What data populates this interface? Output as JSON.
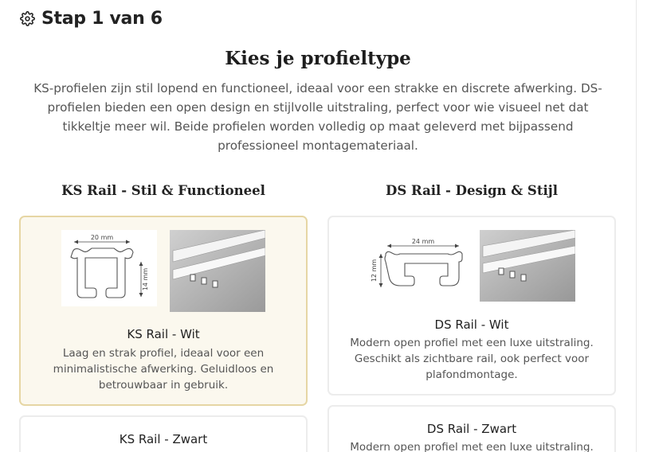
{
  "step": {
    "title": "Stap 1 van 6",
    "icon": "gear-icon"
  },
  "heading": "Kies je profieltype",
  "intro": "KS-profielen zijn stil lopend en functioneel, ideaal voor een strakke en discrete afwerking. DS-profielen bieden een open design en stijlvolle uitstraling, perfect voor wie visueel net dat tikkeltje meer wil. Beide profielen worden volledig op maat geleverd met bijpassend professioneel montagemateriaal.",
  "columns": {
    "ks": {
      "title": "KS Rail - Stil & Functioneel",
      "cards": [
        {
          "name": "KS Rail - Wit",
          "description": "Laag en strak profiel, ideaal voor een minimalistische afwerking. Geluidloos en betrouwbaar in gebruik.",
          "selected": true,
          "diagram_width_label": "20 mm",
          "diagram_height_label": "14 mm"
        },
        {
          "name": "KS Rail - Zwart",
          "selected": false
        }
      ]
    },
    "ds": {
      "title": "DS Rail - Design & Stijl",
      "cards": [
        {
          "name": "DS Rail - Wit",
          "description": "Modern open profiel met een luxe uitstraling. Geschikt als zichtbare rail, ook perfect voor plafondmontage.",
          "selected": false,
          "diagram_width_label": "24 mm",
          "diagram_height_label": "12 mm"
        },
        {
          "name": "DS Rail - Zwart",
          "description": "Modern open profiel met een luxe uitstraling.",
          "selected": false
        }
      ]
    }
  },
  "colors": {
    "selected_bg": "#fbf8ee",
    "selected_border": "#e6d6a4"
  }
}
